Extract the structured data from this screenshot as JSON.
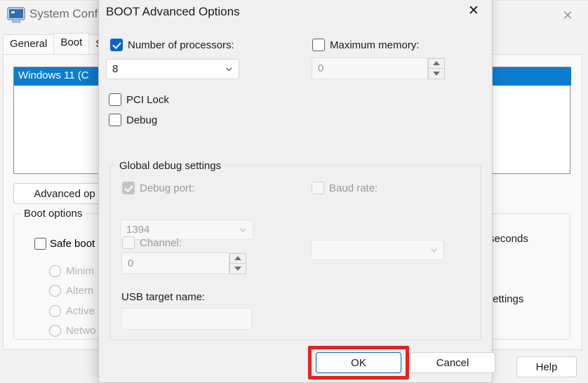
{
  "background_window": {
    "title": "System Confi",
    "icon": "monitor-icon",
    "close_label": "✕",
    "tabs": [
      {
        "label": "General",
        "active": false
      },
      {
        "label": "Boot",
        "active": true
      },
      {
        "label": "S",
        "active": false
      }
    ],
    "boot_list": {
      "selected_item": "Windows 11 (C"
    },
    "advanced_options_button": "Advanced op",
    "boot_options_group": "Boot options",
    "safe_boot_label": "Safe boot",
    "safe_boot_suboptions": [
      "Minim",
      "Altern",
      "Active",
      "Netwo"
    ],
    "timeout_suffix": "seconds",
    "boot_settings_label": "ot settings",
    "help_button": "Help"
  },
  "dialog": {
    "title": "BOOT Advanced Options",
    "close_label": "✕",
    "number_of_processors": {
      "label": "Number of processors:",
      "checked": true,
      "value": "8"
    },
    "maximum_memory": {
      "label": "Maximum memory:",
      "checked": false,
      "value": "0"
    },
    "pci_lock": {
      "label": "PCI Lock",
      "checked": false
    },
    "debug": {
      "label": "Debug",
      "checked": false
    },
    "global_debug_settings": {
      "group_label": "Global debug settings",
      "debug_port": {
        "label": "Debug port:",
        "checked": true,
        "disabled": true,
        "value": "1394"
      },
      "baud_rate": {
        "label": "Baud rate:",
        "checked": false,
        "disabled": true,
        "value": ""
      },
      "channel": {
        "label": "Channel:",
        "checked": false,
        "disabled": true,
        "value": "0"
      },
      "usb_target_name": {
        "label": "USB target name:",
        "value": "",
        "placeholder": ""
      }
    },
    "buttons": {
      "ok": "OK",
      "cancel": "Cancel"
    },
    "highlight_color": "#e8221f",
    "accent_color": "#0a66c2"
  }
}
